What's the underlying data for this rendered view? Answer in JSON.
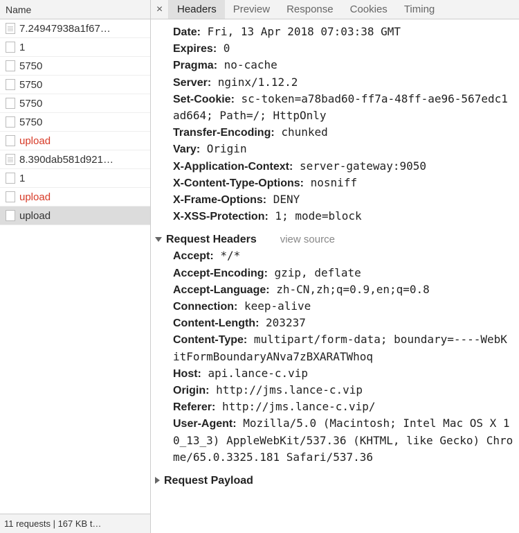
{
  "left": {
    "header": "Name",
    "requests": [
      {
        "name": "7.24947938a1f67…",
        "icon": "doc",
        "red": false
      },
      {
        "name": "1",
        "icon": "blank",
        "red": false
      },
      {
        "name": "5750",
        "icon": "blank",
        "red": false
      },
      {
        "name": "5750",
        "icon": "blank",
        "red": false
      },
      {
        "name": "5750",
        "icon": "blank",
        "red": false
      },
      {
        "name": "5750",
        "icon": "blank",
        "red": false
      },
      {
        "name": "upload",
        "icon": "blank",
        "red": true
      },
      {
        "name": "8.390dab581d921…",
        "icon": "doc",
        "red": false
      },
      {
        "name": "1",
        "icon": "blank",
        "red": false
      },
      {
        "name": "upload",
        "icon": "blank",
        "red": true
      },
      {
        "name": "upload",
        "icon": "blank",
        "red": false,
        "selected": true
      }
    ],
    "footer": "11 requests | 167 KB t…"
  },
  "tabs": {
    "close": "×",
    "items": [
      "Headers",
      "Preview",
      "Response",
      "Cookies",
      "Timing"
    ],
    "active": 0
  },
  "response_headers": [
    {
      "k": "Date:",
      "v": "Fri, 13 Apr 2018 07:03:38 GMT"
    },
    {
      "k": "Expires:",
      "v": "0"
    },
    {
      "k": "Pragma:",
      "v": "no-cache"
    },
    {
      "k": "Server:",
      "v": "nginx/1.12.2"
    },
    {
      "k": "Set-Cookie:",
      "v": "sc-token=a78bad60-ff7a-48ff-ae96-567edc1ad664; Path=/; HttpOnly"
    },
    {
      "k": "Transfer-Encoding:",
      "v": "chunked"
    },
    {
      "k": "Vary:",
      "v": "Origin"
    },
    {
      "k": "X-Application-Context:",
      "v": "server-gateway:9050"
    },
    {
      "k": "X-Content-Type-Options:",
      "v": "nosniff"
    },
    {
      "k": "X-Frame-Options:",
      "v": "DENY"
    },
    {
      "k": "X-XSS-Protection:",
      "v": "1; mode=block"
    }
  ],
  "request_headers_section": {
    "title": "Request Headers",
    "view_source": "view source"
  },
  "request_headers": [
    {
      "k": "Accept:",
      "v": "*/*"
    },
    {
      "k": "Accept-Encoding:",
      "v": "gzip, deflate"
    },
    {
      "k": "Accept-Language:",
      "v": "zh-CN,zh;q=0.9,en;q=0.8"
    },
    {
      "k": "Connection:",
      "v": "keep-alive"
    },
    {
      "k": "Content-Length:",
      "v": "203237"
    },
    {
      "k": "Content-Type:",
      "v": "multipart/form-data; boundary=----WebKitFormBoundaryANva7zBXARATWhoq"
    },
    {
      "k": "Host:",
      "v": "api.lance-c.vip"
    },
    {
      "k": "Origin:",
      "v": "http://jms.lance-c.vip"
    },
    {
      "k": "Referer:",
      "v": "http://jms.lance-c.vip/"
    },
    {
      "k": "User-Agent:",
      "v": "Mozilla/5.0 (Macintosh; Intel Mac OS X 10_13_3) AppleWebKit/537.36 (KHTML, like Gecko) Chrome/65.0.3325.181 Safari/537.36"
    }
  ],
  "request_payload_section": {
    "title": "Request Payload"
  }
}
